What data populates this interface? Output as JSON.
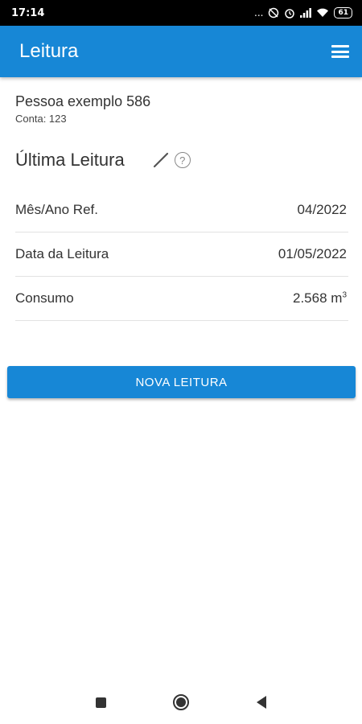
{
  "status_bar": {
    "time": "17:14",
    "dots": "...",
    "battery": "61"
  },
  "app_bar": {
    "title": "Leitura",
    "menu_icon": "menu-icon"
  },
  "person": {
    "name": "Pessoa exemplo 586",
    "account": "Conta: 123"
  },
  "last_reading": {
    "title": "Última Leitura",
    "help_symbol": "?",
    "rows": [
      {
        "label": "Mês/Ano Ref.",
        "value": "04/2022"
      },
      {
        "label": "Data da Leitura",
        "value": "01/05/2022"
      },
      {
        "label": "Consumo",
        "value": "2.568 m",
        "unit_sup": "3"
      }
    ]
  },
  "actions": {
    "new_reading_label": "NOVA LEITURA"
  },
  "colors": {
    "primary": "#1787d6",
    "status_bar": "#000000"
  }
}
